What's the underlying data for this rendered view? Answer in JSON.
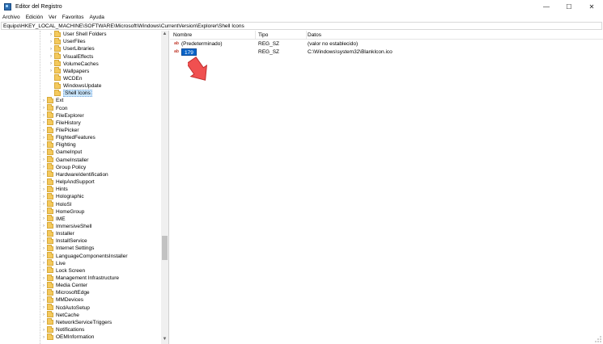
{
  "window": {
    "title": "Editor del Registro",
    "controls": {
      "minimize": "—",
      "maximize": "☐",
      "close": "✕"
    }
  },
  "menu": [
    "Archivo",
    "Edición",
    "Ver",
    "Favoritos",
    "Ayuda"
  ],
  "address": "Equipo\\HKEY_LOCAL_MACHINE\\SOFTWARE\\Microsoft\\Windows\\CurrentVersion\\Explorer\\Shell Icons",
  "tree": {
    "children_level2": [
      {
        "label": "User Shell Folders",
        "expandable": true
      },
      {
        "label": "UserFiles",
        "expandable": true
      },
      {
        "label": "UserLibraries",
        "expandable": true
      },
      {
        "label": "VisualEffects",
        "expandable": true
      },
      {
        "label": "VolumeCaches",
        "expandable": true
      },
      {
        "label": "Wallpapers",
        "expandable": true
      },
      {
        "label": "WCDEn",
        "expandable": false
      },
      {
        "label": "WindowsUpdate",
        "expandable": false
      },
      {
        "label": "Shell Icons",
        "expandable": false,
        "selected": true
      }
    ],
    "children_level1": [
      "Ext",
      "Fcon",
      "FileExplorer",
      "FileHistory",
      "FilePicker",
      "FlightedFeatures",
      "Flighting",
      "GameInput",
      "GameInstaller",
      "Group Policy",
      "HardwareIdentification",
      "HelpAndSupport",
      "Hints",
      "Holographic",
      "HoloSI",
      "HomeGroup",
      "IME",
      "ImmersiveShell",
      "Installer",
      "InstallService",
      "Internet Settings",
      "LanguageComponentsInstaller",
      "Live",
      "Lock Screen",
      "Management Infrastructure",
      "Media Center",
      "MicrosoftEdge",
      "MMDevices",
      "NcdAutoSetup",
      "NetCache",
      "NetworkServiceTriggers",
      "Notifications",
      "OEMInformation"
    ]
  },
  "list": {
    "columns": {
      "name": "Nombre",
      "type": "Tipo",
      "data": "Datos"
    },
    "rows": [
      {
        "name": "(Predeterminado)",
        "type": "REG_SZ",
        "data": "(valor no establecido)"
      },
      {
        "name": "179",
        "type": "REG_SZ",
        "data": "C:\\Windows\\system32\\BlankIcon.ico",
        "editing": true
      }
    ]
  },
  "colors": {
    "selection": "#cce8ff",
    "edit": "#0a64c8",
    "arrow": "#f05050"
  },
  "scroll": {
    "tree_position": 0.66
  }
}
